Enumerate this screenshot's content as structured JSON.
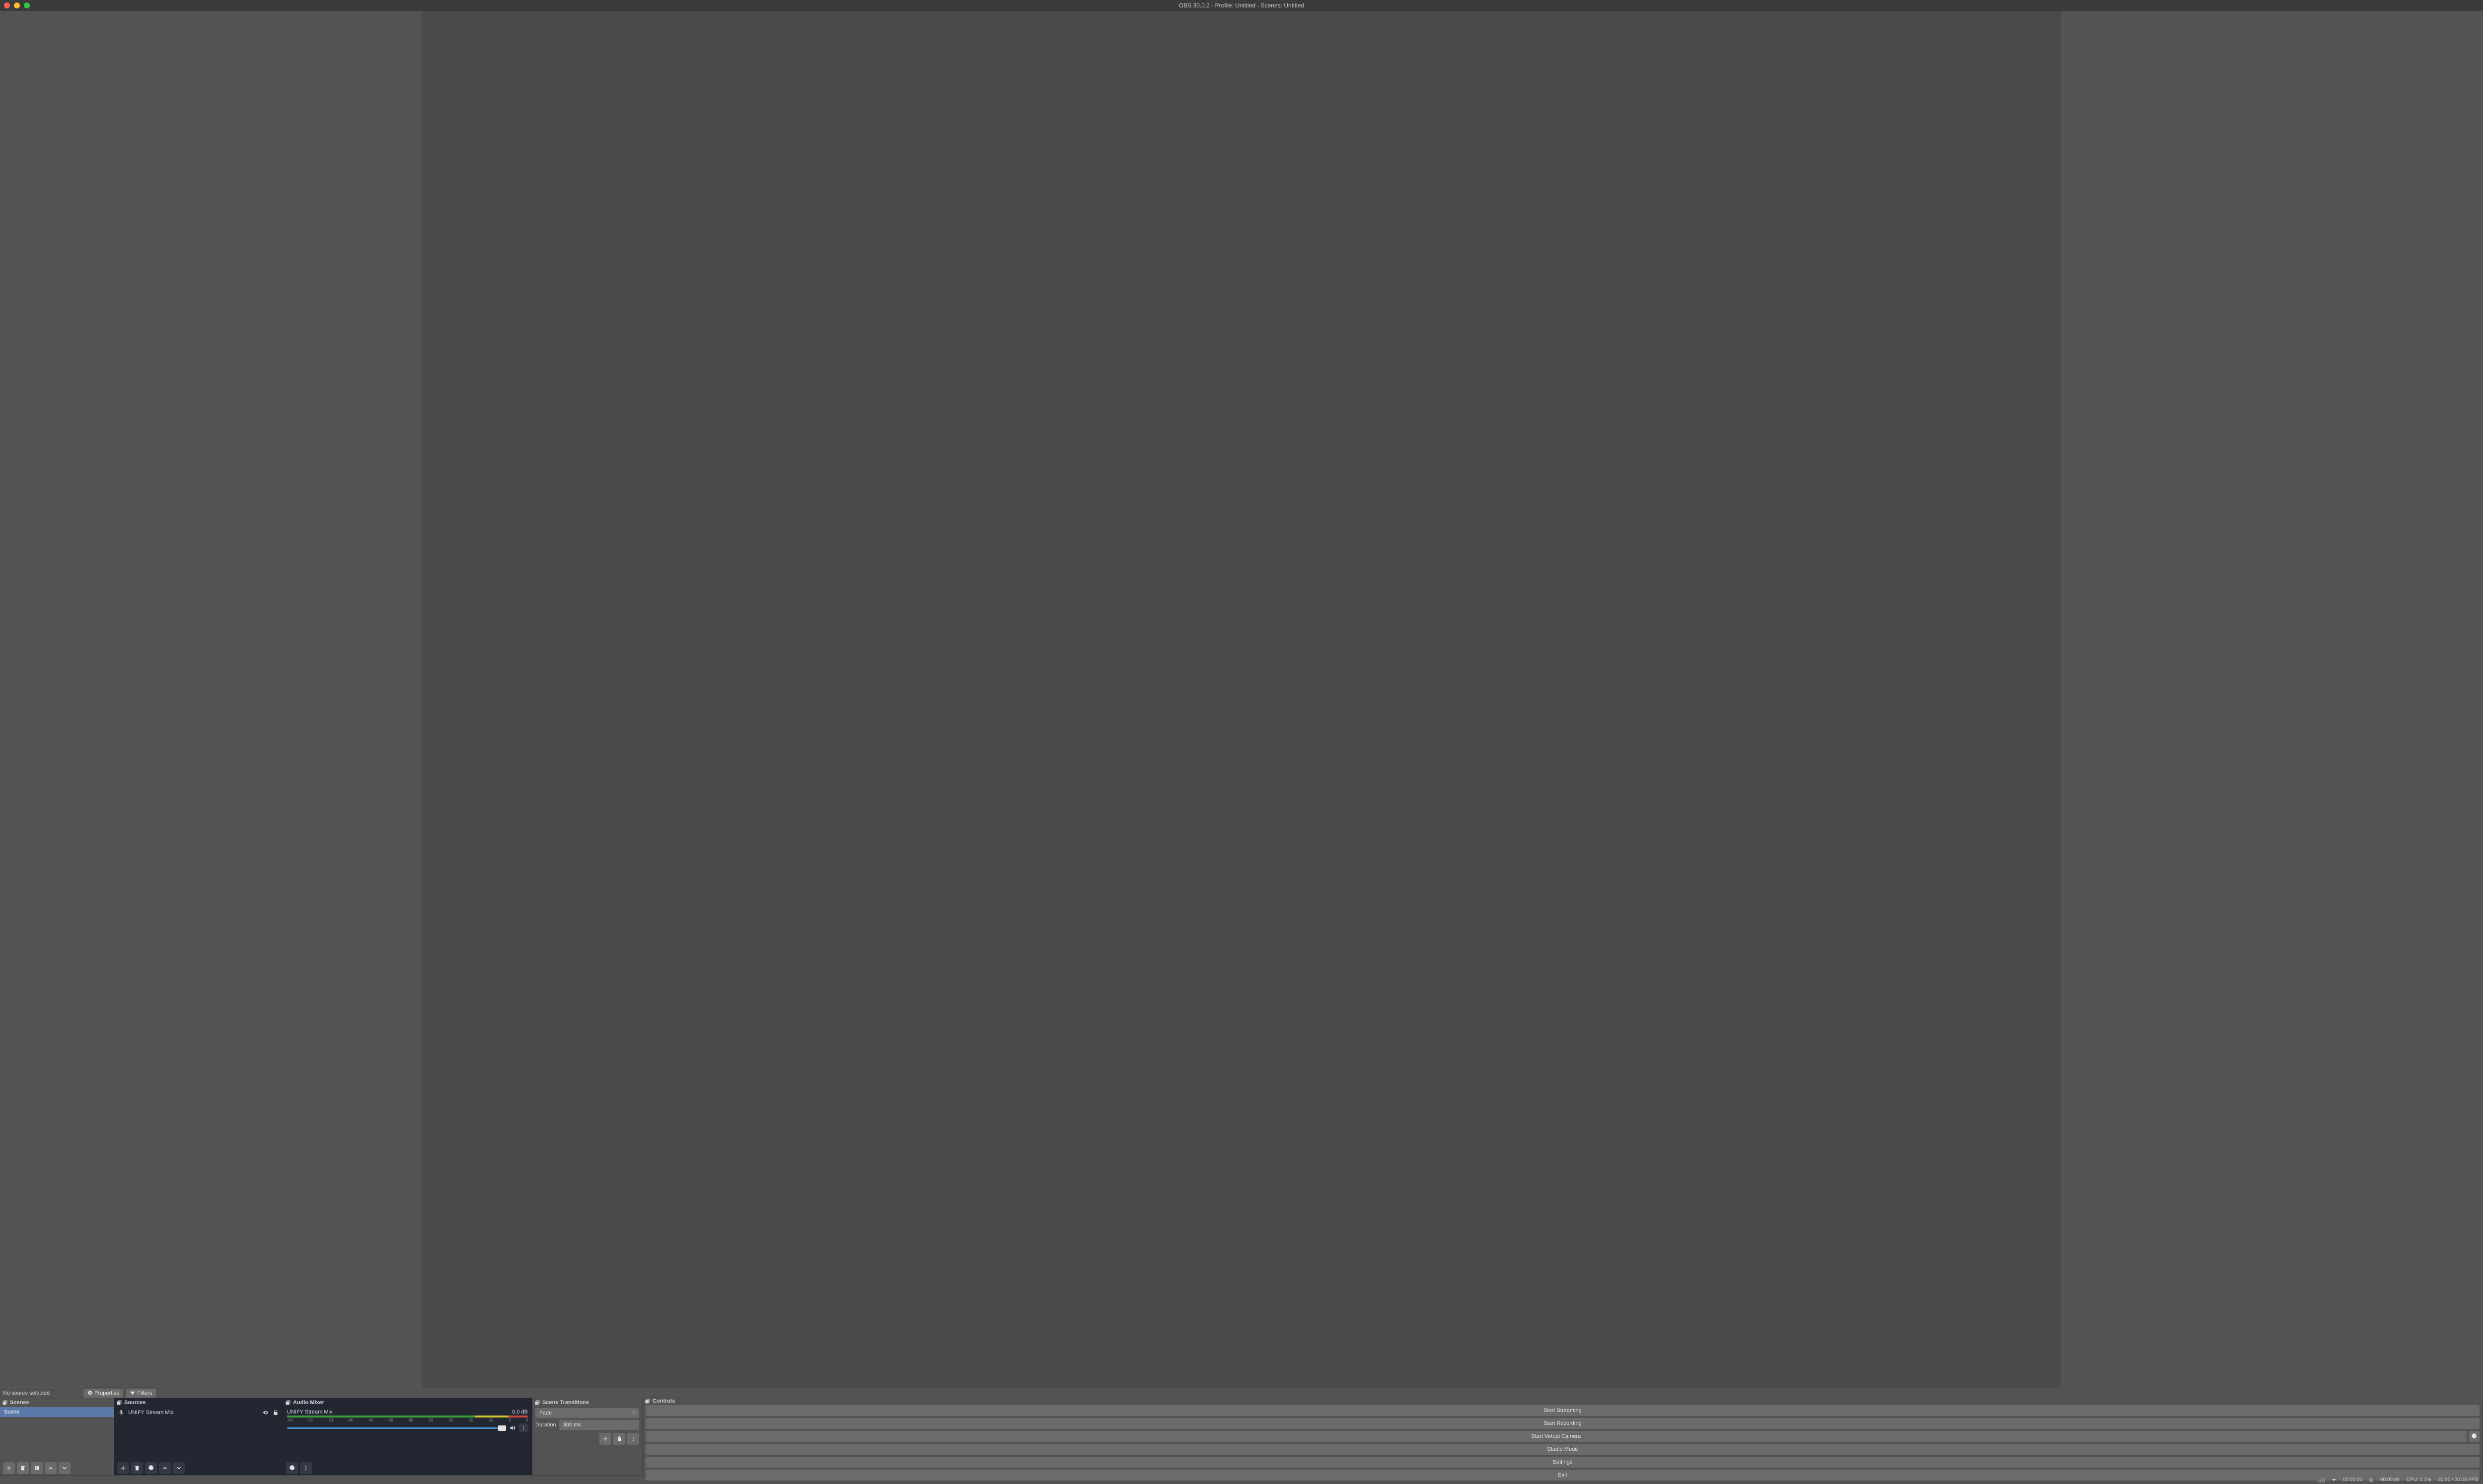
{
  "window": {
    "title": "OBS 30.0.2 - Profile: Untitled - Scenes: Untitled"
  },
  "srcbar": {
    "status": "No source selected",
    "properties": "Properties",
    "filters": "Filters"
  },
  "scenes": {
    "title": "Scenes",
    "items": [
      {
        "label": "Scene",
        "selected": true
      }
    ]
  },
  "sources": {
    "title": "Sources",
    "items": [
      {
        "label": "UNIFY Stream Mix",
        "type": "mic"
      }
    ]
  },
  "mixer": {
    "title": "Audio Mixer",
    "channels": [
      {
        "name": "UNIFY Stream Mix",
        "level_db": "0.0 dB",
        "ticks": [
          "-60",
          "-55",
          "-50",
          "-45",
          "-40",
          "-35",
          "-30",
          "-25",
          "-20",
          "-15",
          "-10",
          "-5",
          "0"
        ]
      }
    ]
  },
  "transitions": {
    "title": "Scene Transitions",
    "selected": "Fade",
    "duration_label": "Duration",
    "duration_value": "300 ms"
  },
  "controls": {
    "title": "Controls",
    "start_streaming": "Start Streaming",
    "start_recording": "Start Recording",
    "start_virtual_camera": "Start Virtual Camera",
    "studio_mode": "Studio Mode",
    "settings": "Settings",
    "exit": "Exit"
  },
  "status": {
    "live_time": "00:00:00",
    "rec_time": "00:00:00",
    "cpu": "CPU: 2.1%",
    "fps": "30.00 / 30.00 FPS"
  }
}
